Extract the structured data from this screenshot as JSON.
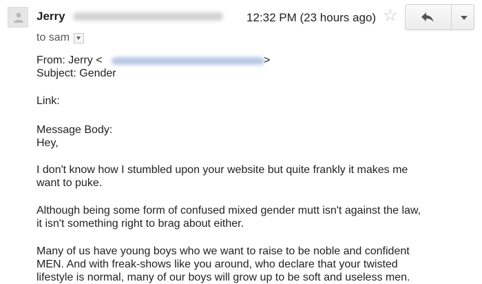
{
  "header": {
    "sender_name": "Jerry",
    "timestamp": "12:32 PM (23 hours ago)",
    "recipient_label": "to sam"
  },
  "icons": {
    "avatar": "person-icon",
    "star": "star-icon",
    "reply": "reply-icon",
    "more": "chevron-down-icon",
    "recipient_details": "chevron-down-icon"
  },
  "message": {
    "from_prefix": "From: Jerry <",
    "from_suffix": ">",
    "subject": "Subject: Gender",
    "link": "Link:",
    "body_label": "Message Body:",
    "greeting": "Hey,",
    "p1_l1": "I don't know how I stumbled upon your website but quite frankly it makes me",
    "p1_l2": "want to puke.",
    "p2_l1": "Although being some form of confused mixed gender mutt isn't against the law,",
    "p2_l2": "it isn't something right to brag about either.",
    "p3_l1": "Many of us have young boys who we want to raise to be noble and confident",
    "p3_l2": "MEN. And with freak-shows like you around, who declare that your twisted",
    "p3_l3": "lifestyle is normal, many of our boys will grow up to be soft and useless men."
  },
  "colors": {
    "star": "#c6c6c6",
    "redaction_blur": "#9fb4dc"
  }
}
